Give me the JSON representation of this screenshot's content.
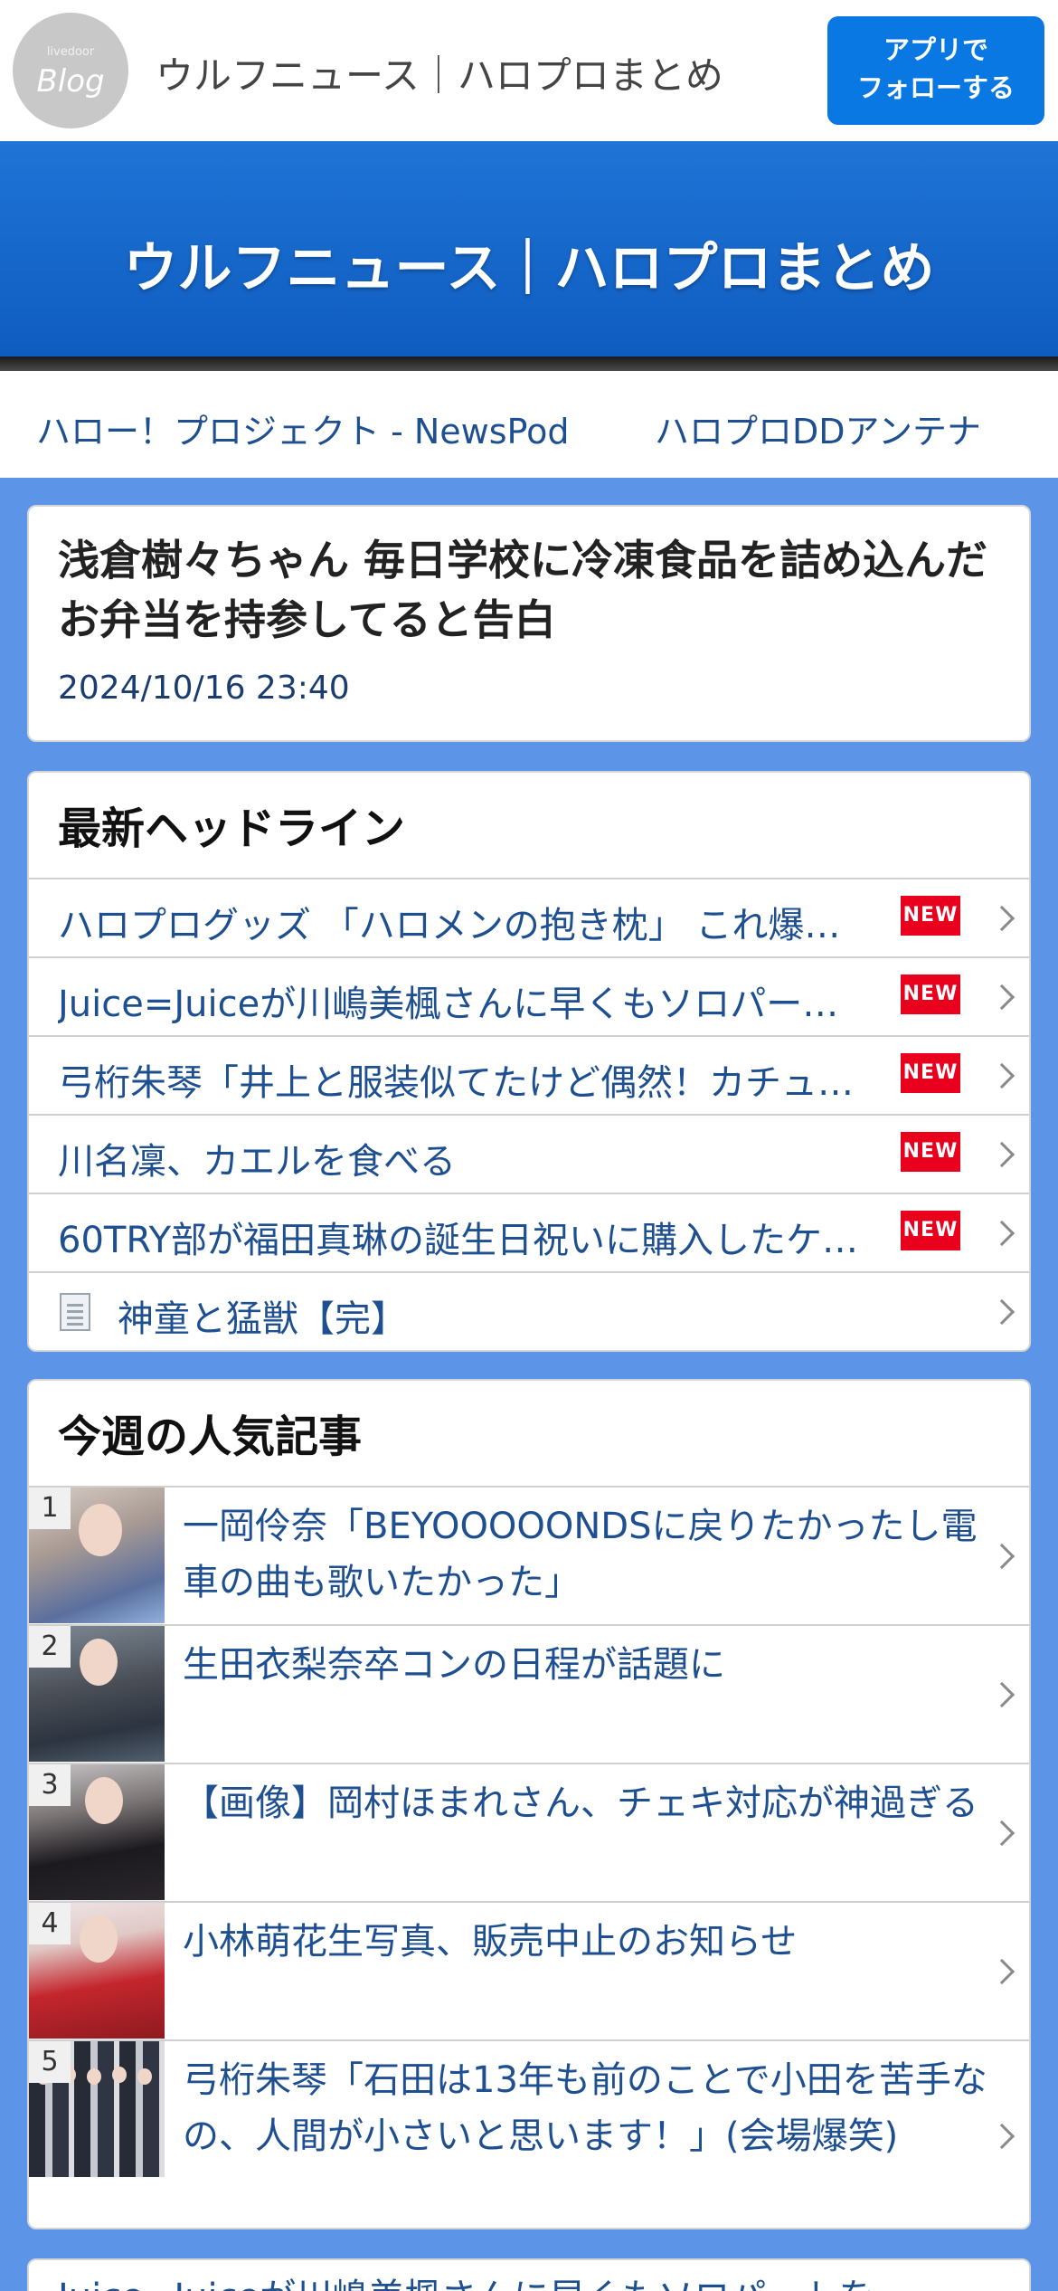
{
  "topbar": {
    "logo_small": "livedoor",
    "logo_big": "Blog",
    "site_title": "ウルフニュース｜ハロプロまとめ",
    "follow_line1": "アプリで",
    "follow_line2": "フォローする"
  },
  "banner": {
    "title": "ウルフニュース｜ハロプロまとめ"
  },
  "links": [
    "ハロー！プロジェクト - NewsPod",
    "ハロプロDDアンテナ"
  ],
  "article": {
    "title": "浅倉樹々ちゃん 毎日学校に冷凍食品を詰め込んだお弁当を持参してると告白",
    "date": "2024/10/16 23:40"
  },
  "headlines": {
    "heading": "最新ヘッドライン",
    "new_label": "NEW",
    "items": [
      {
        "text": "ハロプログッズ 「ハロメンの抱き枕」 これ爆…",
        "new": true
      },
      {
        "text": "Juice=Juiceが川嶋美楓さんに早くもソロパー…",
        "new": true
      },
      {
        "text": "弓桁朱琴「井上と服装似てたけど偶然！カチュ…",
        "new": true
      },
      {
        "text": "川名凜、カエルを食べる",
        "new": true
      },
      {
        "text": "60TRY部が福田真琳の誕生日祝いに購入したケ…",
        "new": true
      },
      {
        "text": "神童と猛獣【完】",
        "new": false,
        "icon": "document-icon"
      }
    ]
  },
  "popular": {
    "heading": "今週の人気記事",
    "items": [
      {
        "rank": "1",
        "text": "一岡伶奈「BEYOOOOONDSに戻りたかったし電車の曲も歌いたかった」"
      },
      {
        "rank": "2",
        "text": "生田衣梨奈卒コンの日程が話題に"
      },
      {
        "rank": "3",
        "text": "【画像】岡村ほまれさん、チェキ対応が神過ぎる"
      },
      {
        "rank": "4",
        "text": "小林萌花生写真、販売中止のお知らせ"
      },
      {
        "rank": "5",
        "text": "弓桁朱琴「石田は13年も前のことで小田を苦手なの、人間が小さいと思います！」(会場爆笑)"
      }
    ]
  },
  "next_card": {
    "text": "Juice=Juiceが川嶋美楓さんに早くもソロパートを"
  },
  "colors": {
    "accent": "#0a78e2",
    "banner": "#1f74d6",
    "link": "#1e4f90",
    "new_badge": "#e8001c",
    "page_bg": "#5c95e8"
  }
}
